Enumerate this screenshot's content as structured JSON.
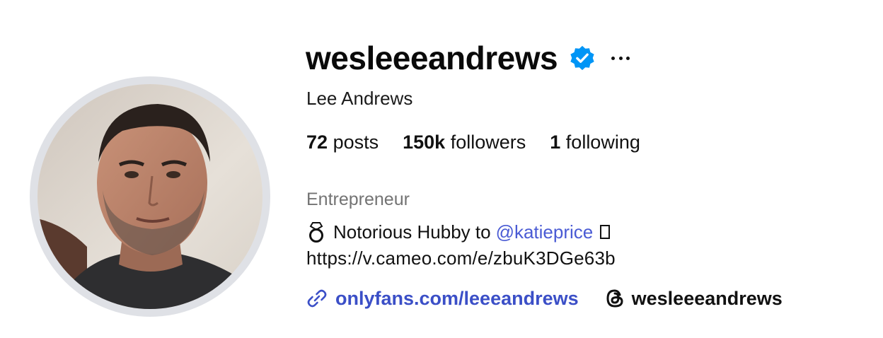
{
  "profile": {
    "username": "wesleeeandrews",
    "verified": true,
    "full_name": "Lee Andrews",
    "category": "Entrepreneur",
    "avatar_icon": "profile-photo"
  },
  "stats": {
    "posts_count": "72",
    "posts_label": "posts",
    "followers_count": "150k",
    "followers_label": "followers",
    "following_count": "1",
    "following_label": "following"
  },
  "bio": {
    "line1_prefix": "Notorious Hubby to",
    "mention": "@katieprice",
    "line2": "https://v.cameo.com/e/zbuK3DGe63b"
  },
  "links": {
    "external_url": "onlyfans.com/leeeandrews",
    "threads_handle": "wesleeeandrews"
  },
  "colors": {
    "verified_blue": "#0095f6",
    "link_blue": "#3b4fc7",
    "mention_blue": "#4a5bd4",
    "secondary_text": "#737373"
  }
}
